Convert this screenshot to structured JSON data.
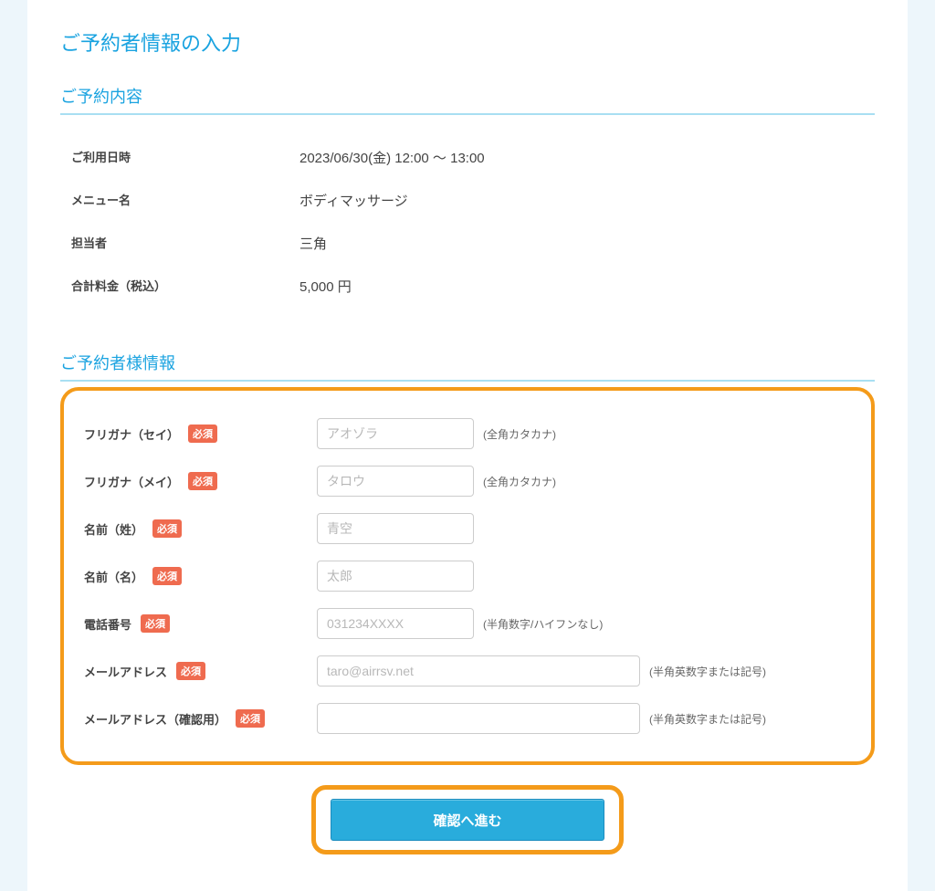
{
  "pageTitle": "ご予約者情報の入力",
  "required_label": "必須",
  "sections": {
    "reservation": {
      "title": "ご予約内容",
      "rows": {
        "datetime": {
          "label": "ご利用日時",
          "value": "2023/06/30(金) 12:00 ～ 13:00"
        },
        "menu": {
          "label": "メニュー名",
          "value": "ボディマッサージ"
        },
        "staff": {
          "label": "担当者",
          "value": "三角"
        },
        "total": {
          "label": "合計料金（税込）",
          "value": "5,000 円"
        }
      }
    },
    "customer": {
      "title": "ご予約者様情報",
      "fields": {
        "furigana_sei": {
          "label": "フリガナ（セイ）",
          "placeholder": "アオゾラ",
          "hint": "(全角カタカナ)",
          "input_width": "small"
        },
        "furigana_mei": {
          "label": "フリガナ（メイ）",
          "placeholder": "タロウ",
          "hint": "(全角カタカナ)",
          "input_width": "small"
        },
        "name_sei": {
          "label": "名前（姓）",
          "placeholder": "青空",
          "hint": "",
          "input_width": "small"
        },
        "name_mei": {
          "label": "名前（名）",
          "placeholder": "太郎",
          "hint": "",
          "input_width": "small"
        },
        "tel": {
          "label": "電話番号",
          "placeholder": "031234XXXX",
          "hint": "(半角数字/ハイフンなし)",
          "input_width": "small"
        },
        "email": {
          "label": "メールアドレス",
          "placeholder": "taro@airrsv.net",
          "hint": "(半角英数字または記号)",
          "input_width": "large"
        },
        "email_confirm": {
          "label": "メールアドレス（確認用）",
          "placeholder": "",
          "hint": "(半角英数字または記号)",
          "input_width": "large"
        }
      }
    }
  },
  "submit_label": "確認へ進む"
}
